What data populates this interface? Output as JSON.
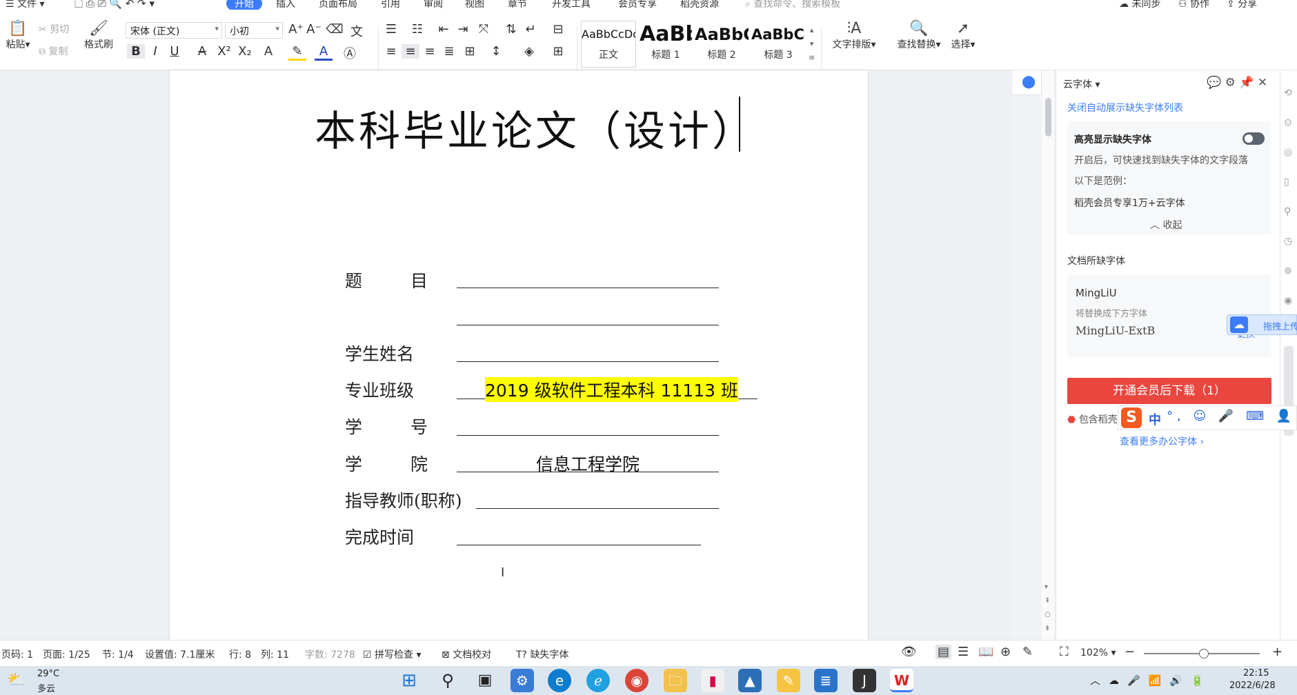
{
  "menu": {
    "file": "文件",
    "tabs": [
      "开始",
      "插入",
      "页面布局",
      "引用",
      "审阅",
      "视图",
      "章节",
      "开发工具",
      "会员专享",
      "稻壳资源"
    ],
    "search_placeholder": "查找命令、搜索模板",
    "right": [
      "未同步",
      "协作",
      "分享"
    ]
  },
  "ribbon": {
    "paste": "粘贴",
    "cut": "剪切",
    "copy": "复制",
    "format_painter": "格式刷",
    "font_name": "宋体 (正文)",
    "font_size": "小初",
    "styles": [
      {
        "sample": "AaBbCcDd",
        "name": "正文"
      },
      {
        "sample": "AaBb",
        "name": "标题 1"
      },
      {
        "sample": "AaBbC",
        "name": "标题 2"
      },
      {
        "sample": "AaBbCc",
        "name": "标题 3"
      }
    ],
    "text_layout": "文字排版",
    "find_replace": "查找替换",
    "select": "选择"
  },
  "document": {
    "title": "本科毕业论文（设计）",
    "fields": [
      {
        "label": "题　　目",
        "value": ""
      },
      {
        "label": "",
        "value": ""
      },
      {
        "label": "学生姓名",
        "value": ""
      },
      {
        "label": "专业班级",
        "value": "2019 级软件工程本科 11113 班"
      },
      {
        "label": "学　　号",
        "value": ""
      },
      {
        "label": "学　　院",
        "value": "信息工程学院"
      },
      {
        "label": "指导教师(职称)",
        "value": ""
      },
      {
        "label": "完成时间",
        "value": ""
      }
    ]
  },
  "panel": {
    "title": "云字体",
    "close_auto": "关闭自动展示缺失字体列表",
    "highlight_title": "高亮显示缺失字体",
    "highlight_desc": "开启后，可快速找到缺失字体的文字段落",
    "example_label": "以下是范例：",
    "example_text": "稻壳会员专享1万+云字体",
    "collapse": "收起",
    "missing_title": "文档所缺字体",
    "missing_font": "MingLiU",
    "replace_label": "将替换成下方字体",
    "replacement_font": "MingLiU-ExtB",
    "download_button": "开通会员后下载（1）",
    "include_text": "包含稻壳",
    "more_fonts": "查看更多办公字体",
    "float_tip": "拖拽上传",
    "float_text": "更换"
  },
  "status": {
    "page_code": "页码: 1",
    "page": "页面: 1/25",
    "section": "节: 1/4",
    "setting": "设置值: 7.1厘米",
    "row": "行: 8",
    "col": "列: 11",
    "word_count": "字数: 7278",
    "spell_check": "拼写检查",
    "proofread": "文档校对",
    "missing_font": "缺失字体",
    "zoom": "102%"
  },
  "taskbar": {
    "weather_temp": "29°C",
    "weather_desc": "多云",
    "time": "22:15",
    "date": "2022/6/28"
  },
  "ime": {
    "lang": "中"
  },
  "colors": {
    "accent": "#3d7cf7",
    "download_red": "#e9463f",
    "highlight_yellow": "#ffff00"
  }
}
